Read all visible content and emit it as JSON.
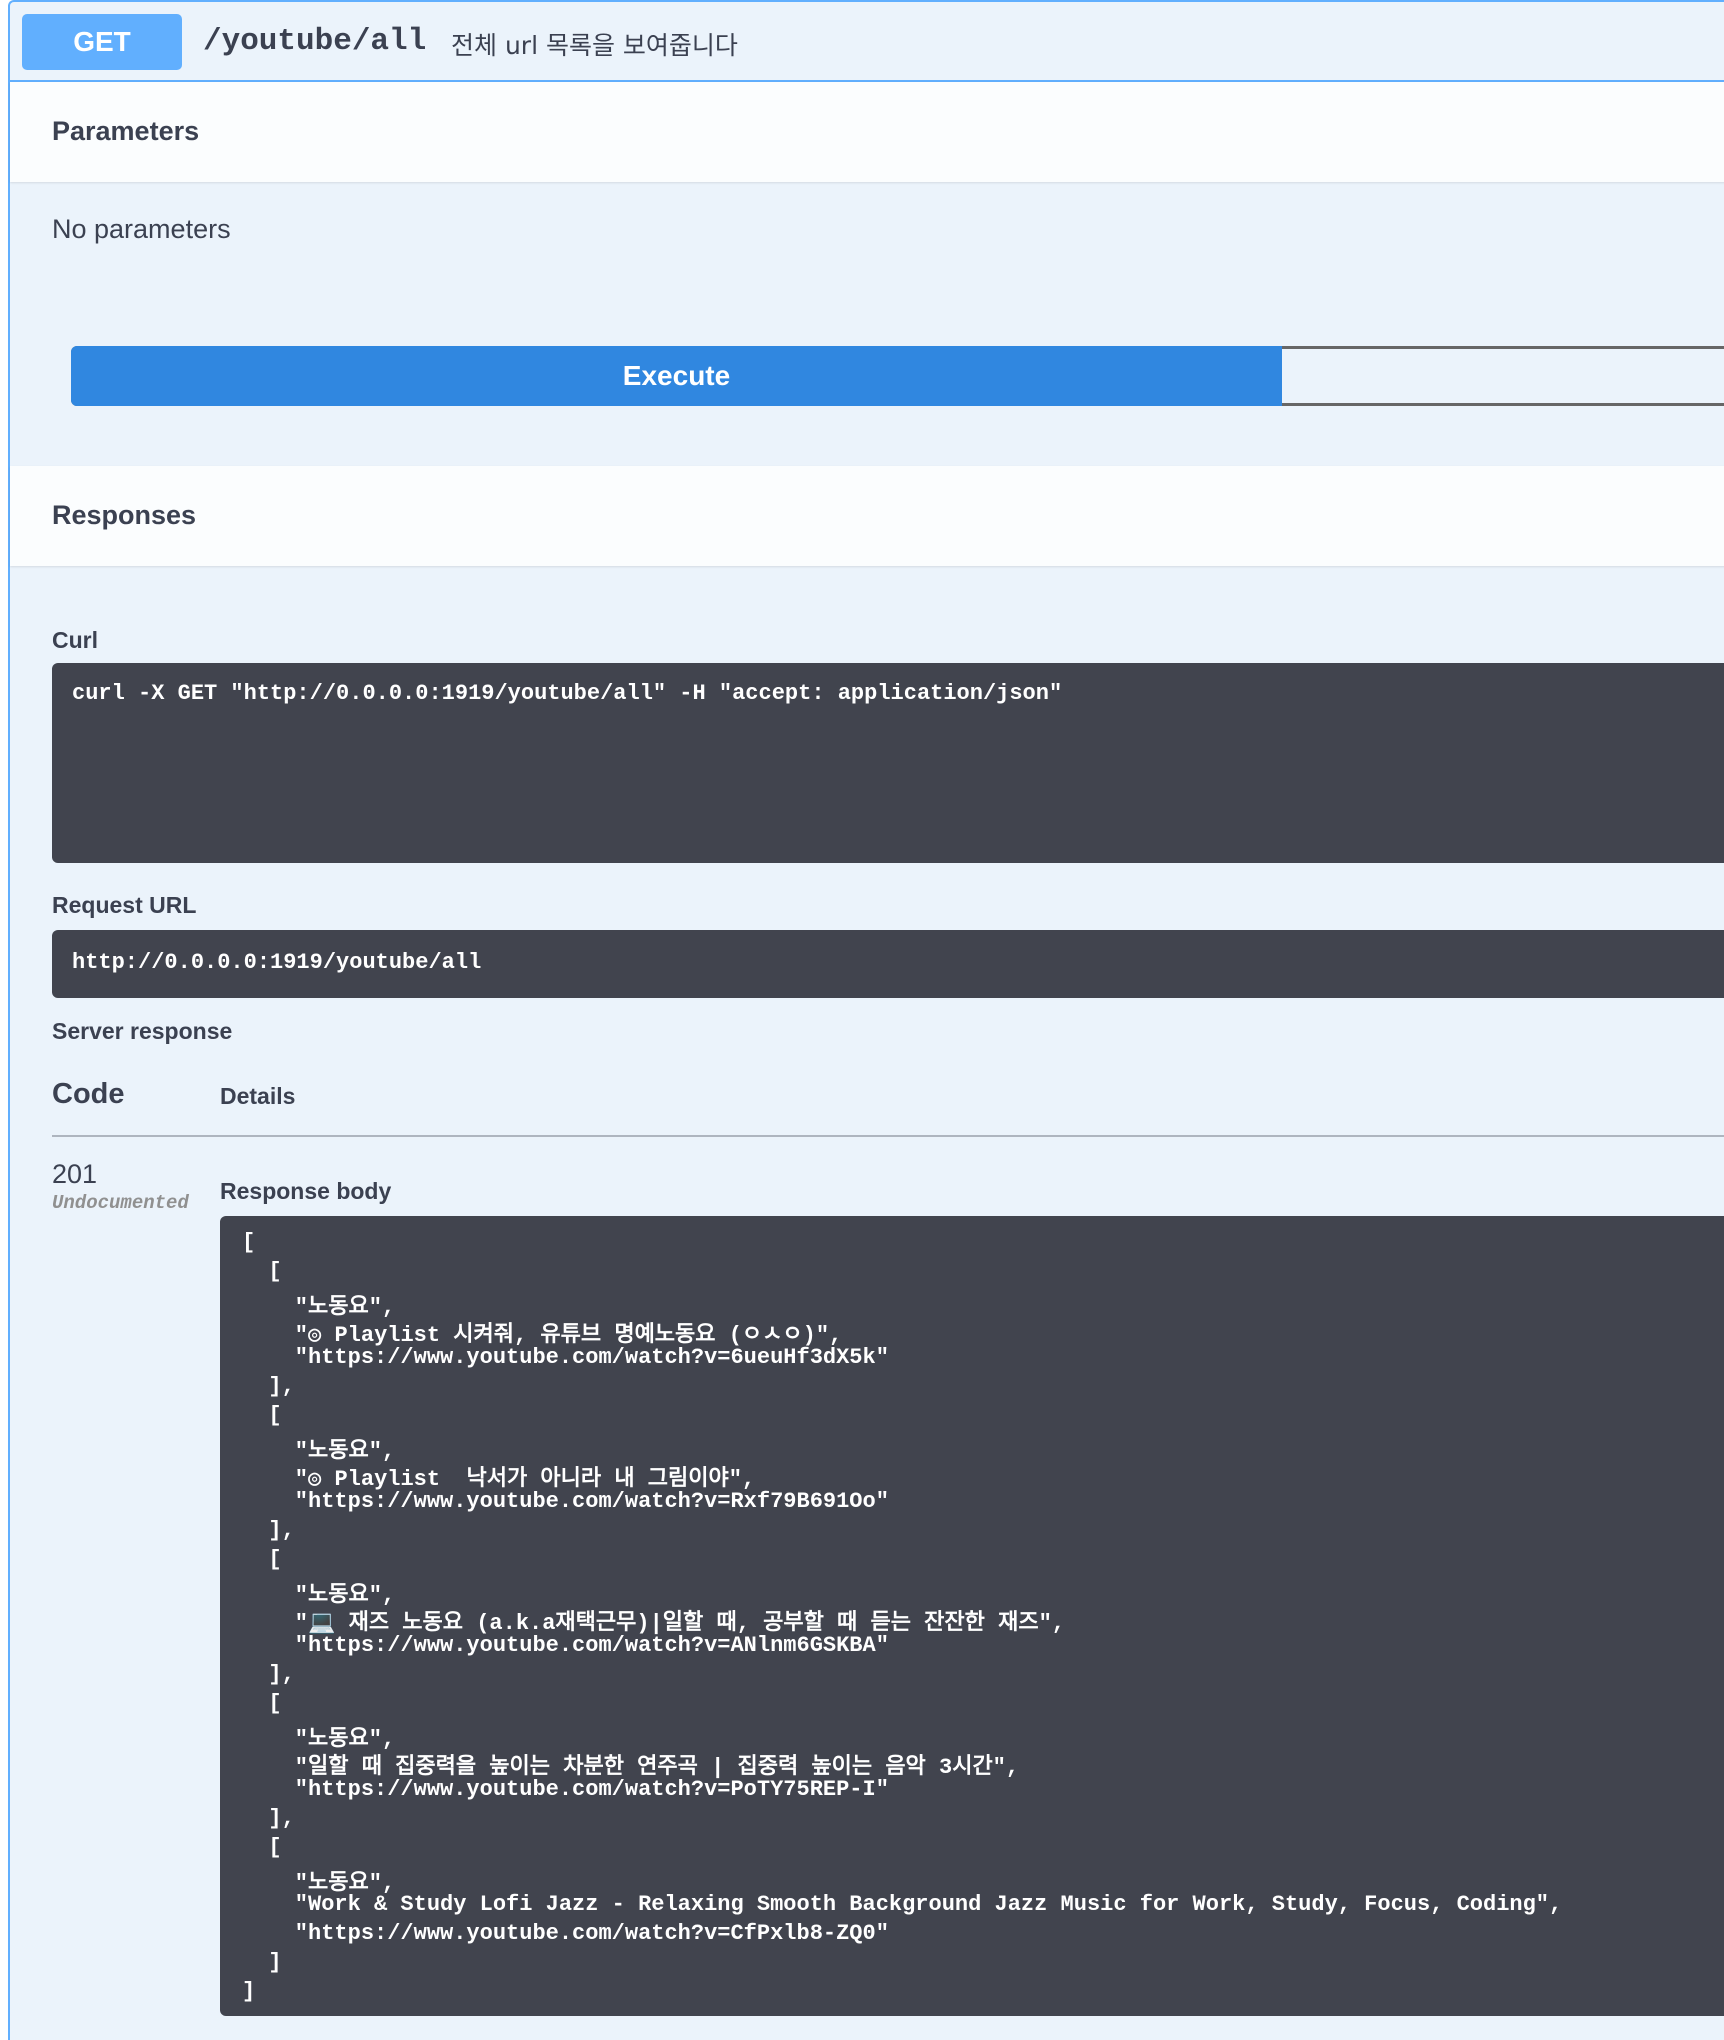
{
  "operation": {
    "method": "GET",
    "path": "/youtube/all",
    "description": "전체 url 목록을 보여줍니다"
  },
  "parameters": {
    "title": "Parameters",
    "empty_text": "No parameters"
  },
  "execute_label": "Execute",
  "responses": {
    "title": "Responses",
    "curl_label": "Curl",
    "curl_command": "curl -X GET \"http://0.0.0.0:1919/youtube/all\" -H \"accept: application/json\"",
    "request_url_label": "Request URL",
    "request_url": "http://0.0.0.0:1919/youtube/all",
    "server_response_label": "Server response",
    "table": {
      "code_header": "Code",
      "details_header": "Details"
    },
    "status_code": "201",
    "status_note": "Undocumented",
    "response_body_label": "Response body",
    "response_body_lines": [
      "[",
      "  [",
      "    \"노동요\",",
      "    \"◎ Playlist 시켜줘, 유튜브 명예노동요 (ㅇㅅㅇ)\",",
      "    \"https://www.youtube.com/watch?v=6ueuHf3dX5k\"",
      "  ],",
      "  [",
      "    \"노동요\",",
      "    \"◎ Playlist  낙서가 아니라 내 그림이야\",",
      "    \"https://www.youtube.com/watch?v=Rxf79B691Oo\"",
      "  ],",
      "  [",
      "    \"노동요\",",
      "    \"💻 재즈 노동요 (a.k.a재택근무)|일할 때, 공부할 때 듣는 잔잔한 재즈\",",
      "    \"https://www.youtube.com/watch?v=ANlnm6GSKBA\"",
      "  ],",
      "  [",
      "    \"노동요\",",
      "    \"일할 때 집중력을 높이는 차분한 연주곡 | 집중력 높이는 음악 3시간\",",
      "    \"https://www.youtube.com/watch?v=PoTY75REP-I\"",
      "  ],",
      "  [",
      "    \"노동요\",",
      "    \"Work & Study Lofi Jazz - Relaxing Smooth Background Jazz Music for Work, Study, Focus, Coding\",",
      "    \"https://www.youtube.com/watch?v=CfPxlb8-ZQ0\"",
      "  ]",
      "]"
    ]
  },
  "colors": {
    "get_method": "#61affe",
    "execute": "#3087e0",
    "code_background": "#41444e",
    "block_background": "#ebf3fb"
  }
}
